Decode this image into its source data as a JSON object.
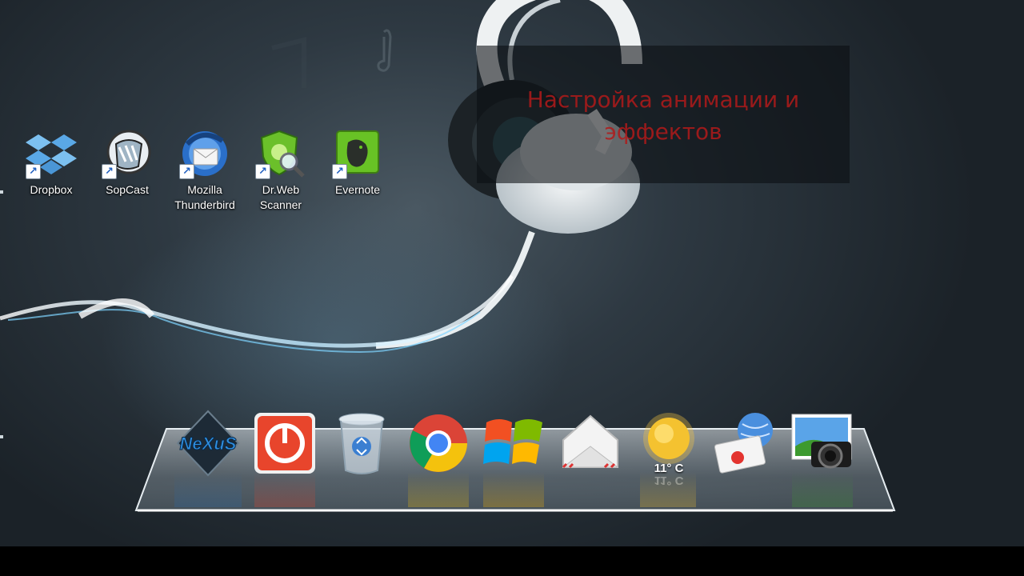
{
  "desktop": {
    "icons": [
      {
        "label": "Dropbox",
        "icon": "dropbox-icon"
      },
      {
        "label": "SopCast",
        "icon": "sopcast-icon"
      },
      {
        "label": "Mozilla\nThunderbird",
        "icon": "thunderbird-icon"
      },
      {
        "label": "Dr.Web\nScanner",
        "icon": "drweb-scanner-icon"
      },
      {
        "label": "Evernote",
        "icon": "evernote-icon"
      }
    ],
    "wallpaper": "headphones-wallpaper"
  },
  "overlay": {
    "caption": "Настройка анимации и эффектов",
    "caption_color": "#b11a1a"
  },
  "dock": {
    "items": [
      {
        "name": "nexus-icon",
        "label": "NeXuS"
      },
      {
        "name": "power-icon"
      },
      {
        "name": "recycle-bin-icon"
      },
      {
        "name": "chrome-icon"
      },
      {
        "name": "windows-icon"
      },
      {
        "name": "mail-icon"
      },
      {
        "name": "weather-sun-icon",
        "temperature": "11° C"
      },
      {
        "name": "email-globe-icon"
      },
      {
        "name": "photo-camera-icon"
      }
    ]
  }
}
